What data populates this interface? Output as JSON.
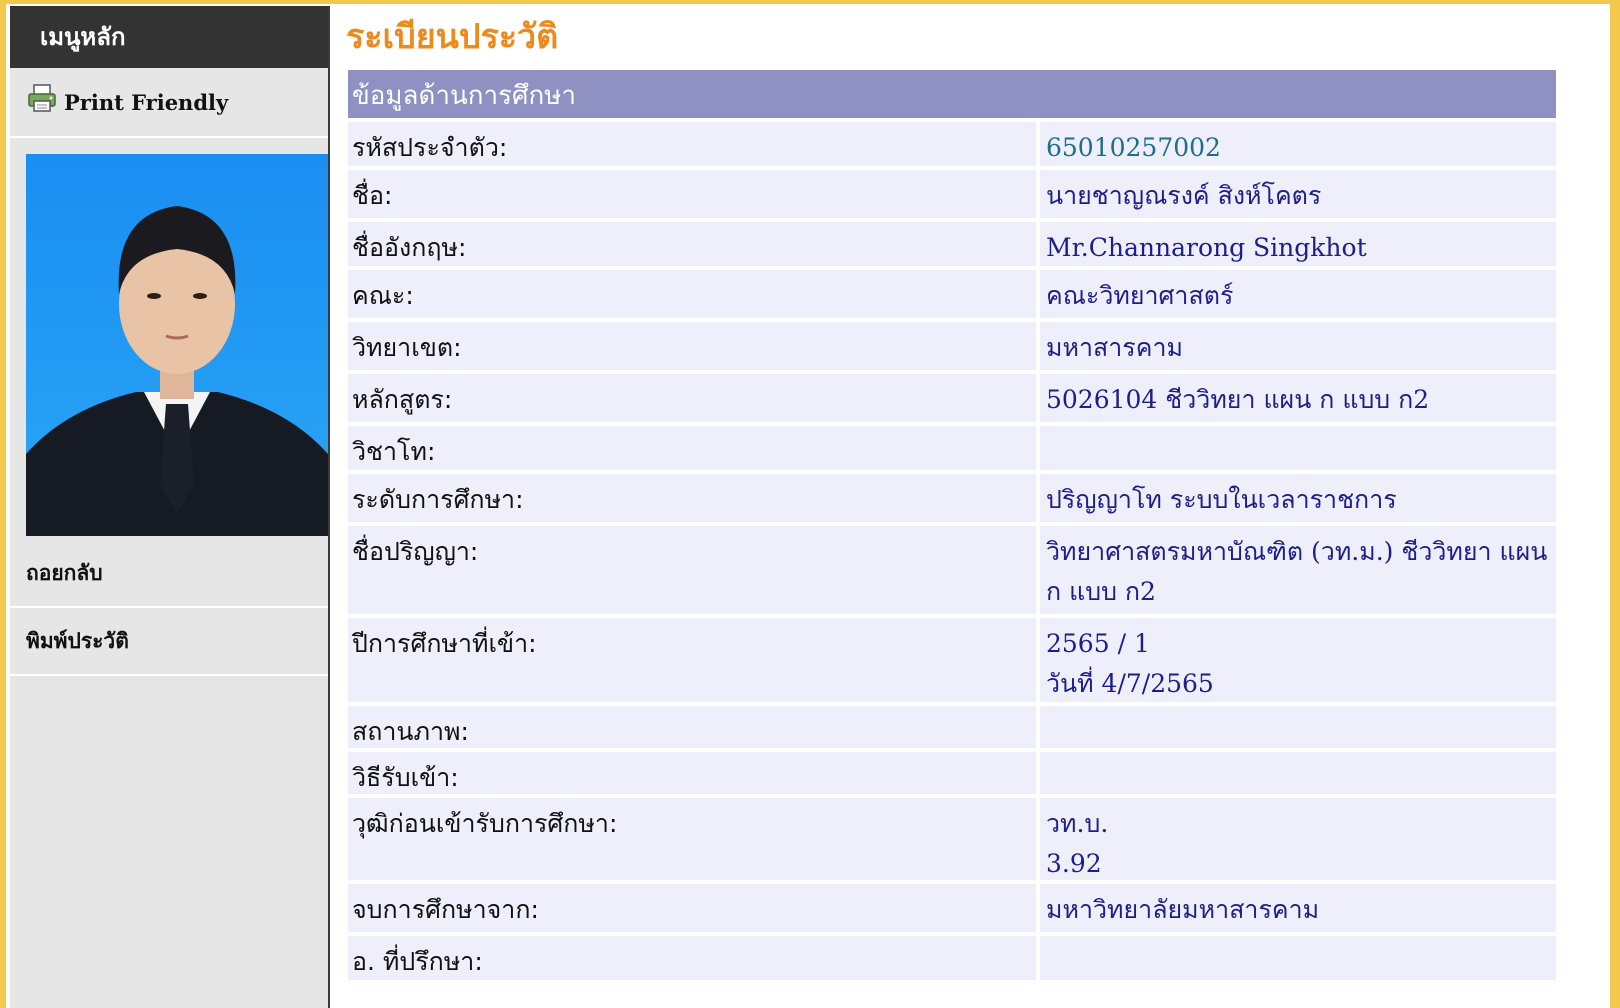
{
  "sidebar": {
    "title": "เมนูหลัก",
    "print_friendly": "Print Friendly",
    "back": "ถอยกลับ",
    "print_history": "พิมพ์ประวัติ"
  },
  "page": {
    "title": "ระเบียนประวัติ",
    "section": "ข้อมูลด้านการศึกษา"
  },
  "rows": [
    {
      "label": "รหัสประจำตัว:",
      "value": [
        "65010257002"
      ],
      "height": 44
    },
    {
      "label": "ชื่อ:",
      "value": [
        "นายชาญณรงค์ สิงห์โคตร"
      ],
      "height": 48
    },
    {
      "label": "ชื่ออังกฤษ:",
      "value": [
        "Mr.Channarong Singkhot"
      ],
      "height": 44
    },
    {
      "label": "คณะ:",
      "value": [
        "คณะวิทยาศาสตร์"
      ],
      "height": 48
    },
    {
      "label": "วิทยาเขต:",
      "value": [
        "มหาสารคาม"
      ],
      "height": 48
    },
    {
      "label": "หลักสูตร:",
      "value": [
        "5026104 ชีววิทยา แผน ก แบบ ก2"
      ],
      "height": 48
    },
    {
      "label": "วิชาโท:",
      "value": [],
      "height": 44
    },
    {
      "label": "ระดับการศึกษา:",
      "value": [
        "ปริญญาโท ระบบในเวลาราชการ"
      ],
      "height": 48
    },
    {
      "label": "ชื่อปริญญา:",
      "value": [
        "วิทยาศาสตรมหาบัณฑิต (วท.ม.) ชีววิทยา แผน",
        "ก แบบ ก2"
      ],
      "height": 88
    },
    {
      "label": "ปีการศึกษาที่เข้า:",
      "value": [
        "2565 / 1",
        "วันที่ 4/7/2565"
      ],
      "height": 84
    },
    {
      "label": "สถานภาพ:",
      "value": [],
      "height": 42
    },
    {
      "label": "วิธีรับเข้า:",
      "value": [],
      "height": 42
    },
    {
      "label": "วุฒิก่อนเข้ารับการศึกษา:",
      "value": [
        "วท.บ.",
        "3.92"
      ],
      "height": 82
    },
    {
      "label": "จบการศึกษาจาก:",
      "value": [
        "มหาวิทยาลัยมหาสารคาม"
      ],
      "height": 48
    },
    {
      "label": "อ. ที่ปรึกษา:",
      "value": [],
      "height": 44
    }
  ]
}
